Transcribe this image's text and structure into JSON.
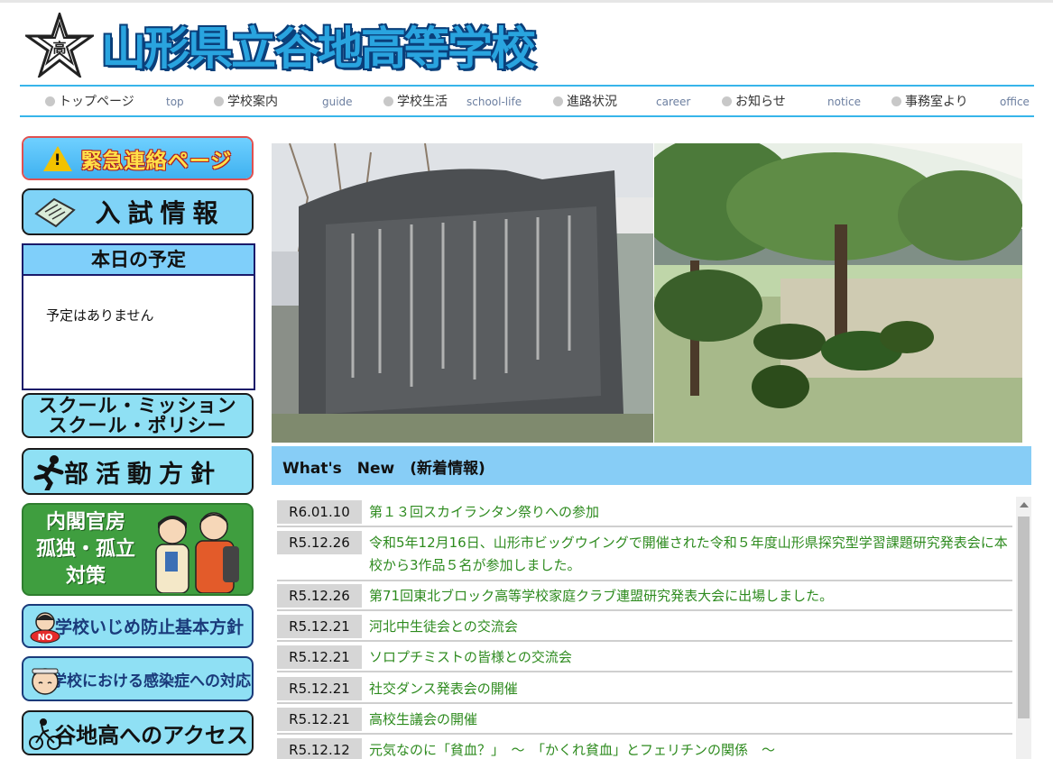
{
  "header": {
    "logo_text": "高",
    "site_title": "山形県立谷地高等学校"
  },
  "nav": {
    "items": [
      {
        "label": "トップページ",
        "en": "top"
      },
      {
        "label": "学校案内",
        "en": "guide"
      },
      {
        "label": "学校生活",
        "en": "school-life"
      },
      {
        "label": "進路状況",
        "en": "career"
      },
      {
        "label": "お知らせ",
        "en": "notice"
      },
      {
        "label": "事務室より",
        "en": "office"
      }
    ]
  },
  "sidebar": {
    "emergency": "緊急連絡ページ",
    "emergency_icon_mark": "!",
    "exam": "入試情報",
    "schedule": {
      "title": "本日の予定",
      "body": "予定はありません"
    },
    "mission_line1": "スクール・ミッション",
    "mission_line2": "スクール・ポリシー",
    "club": "部活動方針",
    "koritsu_line1": "内閣官房",
    "koritsu_line2": "孤独・孤立",
    "koritsu_line3": "対策",
    "ijime": "学校いじめ防止基本方針",
    "ijime_badge": "NO",
    "kansen": "学校における感染症への対応",
    "access": "谷地高へのアクセス"
  },
  "news": {
    "header": "What's　New　(新着情報)",
    "items": [
      {
        "date": "R6.01.10",
        "title": "第１３回スカイランタン祭りへの参加"
      },
      {
        "date": "R5.12.26",
        "title": "令和5年12月16日、山形市ビッグウイングで開催された令和５年度山形県探究型学習課題研究発表会に本校から3作品５名が参加しました。"
      },
      {
        "date": "R5.12.26",
        "title": "第71回東北ブロック高等学校家庭クラブ連盟研究発表大会に出場しました。"
      },
      {
        "date": "R5.12.21",
        "title": "河北中生徒会との交流会"
      },
      {
        "date": "R5.12.21",
        "title": "ソロプチミストの皆様との交流会"
      },
      {
        "date": "R5.12.21",
        "title": "社交ダンス発表会の開催"
      },
      {
        "date": "R5.12.21",
        "title": "高校生議会の開催"
      },
      {
        "date": "R5.12.12",
        "title": "元気なのに「貧血？」　～　「かくれ貧血」とフェリチンの関係　～"
      }
    ]
  },
  "colors": {
    "accent": "#37b5ea",
    "news_link": "#2e8b1f",
    "title_fill": "#29a4df",
    "title_outline": "#0a3f7a"
  }
}
